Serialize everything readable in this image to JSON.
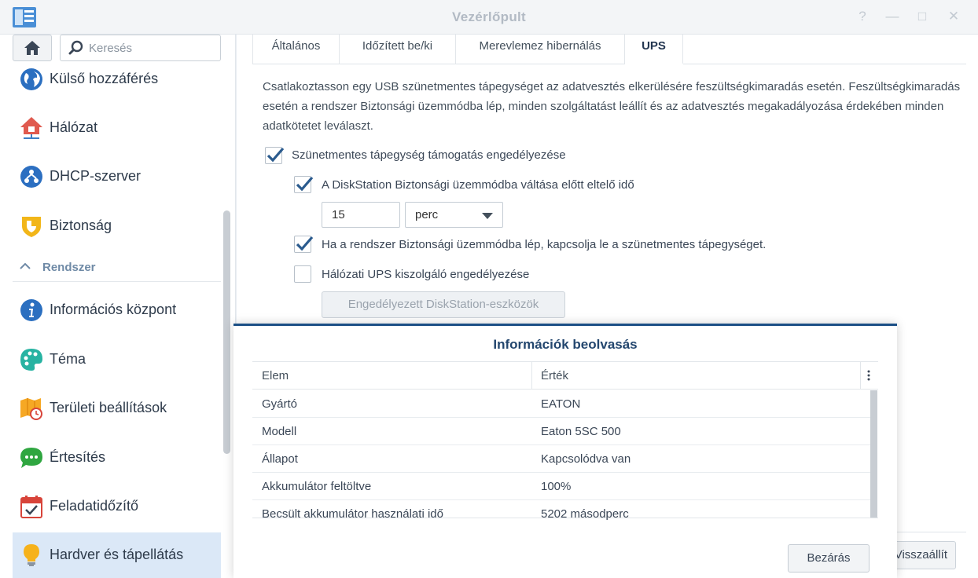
{
  "window": {
    "title": "Vezérlőpult",
    "controls": [
      "?",
      "—",
      "□",
      "✕"
    ]
  },
  "sidebar": {
    "search_placeholder": "Keresés",
    "items_top": [
      {
        "label": "Külső hozzáférés",
        "icon": "globe-icon"
      },
      {
        "label": "Hálózat",
        "icon": "house-network-icon"
      },
      {
        "label": "DHCP-szerver",
        "icon": "dhcp-icon"
      },
      {
        "label": "Biztonság",
        "icon": "shield-icon"
      }
    ],
    "section": "Rendszer",
    "items_system": [
      {
        "label": "Információs központ",
        "icon": "info-icon"
      },
      {
        "label": "Téma",
        "icon": "palette-icon"
      },
      {
        "label": "Területi beállítások",
        "icon": "map-clock-icon"
      },
      {
        "label": "Értesítés",
        "icon": "chat-icon"
      },
      {
        "label": "Feladatidőzítő",
        "icon": "calendar-check-icon"
      },
      {
        "label": "Hardver és tápellátás",
        "icon": "lightbulb-icon",
        "active": true
      }
    ]
  },
  "tabs": [
    {
      "label": "Általános"
    },
    {
      "label": "Időzített be/ki"
    },
    {
      "label": "Merevlemez hibernálás"
    },
    {
      "label": "UPS",
      "active": true
    }
  ],
  "ups": {
    "description": "Csatlakoztasson egy USB szünetmentes tápegységet az adatvesztés elkerülésére feszültségkimaradás esetén. Feszültségkimaradás esetén a rendszer Biztonsági üzemmódba lép, minden szolgáltatást leállít és az adatvesztés megakadályozása érdekében minden adatkötetet leválaszt.",
    "enable_label": "Szünetmentes tápegység támogatás engedélyezése",
    "enable_checked": true,
    "delay_label": "A DiskStation Biztonsági üzemmódba váltása előtt eltelő idő",
    "delay_checked": true,
    "delay_value": "15",
    "delay_unit": "perc",
    "shutdown_label": "Ha a rendszer Biztonsági üzemmódba lép, kapcsolja le a szünetmentes tápegységet.",
    "shutdown_checked": true,
    "network_label": "Hálózati UPS kiszolgáló engedélyezése",
    "network_checked": false,
    "devices_button": "Engedélyezett DiskStation-eszközök",
    "restore_button": "Visszaállít"
  },
  "dialog": {
    "title": "Információk beolvasás",
    "columns": [
      "Elem",
      "Érték"
    ],
    "rows": [
      [
        "Gyártó",
        "EATON"
      ],
      [
        "Modell",
        "Eaton 5SC 500"
      ],
      [
        "Állapot",
        "Kapcsolódva van"
      ],
      [
        "Akkumulátor feltöltve",
        "100%"
      ],
      [
        "Becsült akkumulátor használati idő",
        "5202 másodperc"
      ]
    ],
    "close_button": "Bezárás"
  },
  "colors": {
    "accent": "#1b4f85",
    "active_nav": "#dbe8f7",
    "check": "#2b5b8e"
  }
}
